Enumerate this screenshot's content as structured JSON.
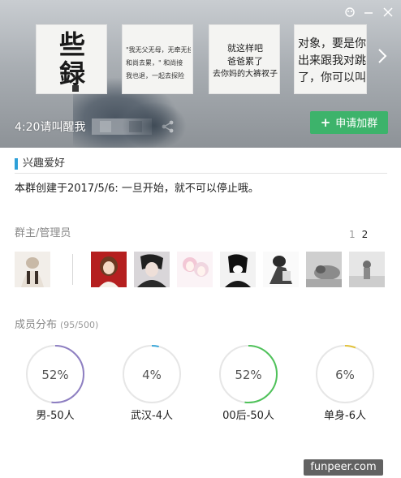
{
  "header": {
    "group_name": "4:20请叫醒我",
    "join_label": "申请加群",
    "thumbnails": [
      {
        "lines": [
          "些",
          "録"
        ]
      },
      {
        "lines": [
          "\"我无父无母，无牵无挂",
          "和尚去累，\" 和尚接",
          "我也退，一起去探险"
        ]
      },
      {
        "lines": [
          "就这样吧",
          "爸爸累了",
          "去你妈的大裤衩子"
        ]
      },
      {
        "lines": [
          "对象，要是你",
          "出来跟我对跳",
          "了，你可以叫"
        ]
      }
    ]
  },
  "interest": {
    "title": "兴趣爱好",
    "intro": "本群创建于2017/5/6:  一旦开始，就不可以停止哦。"
  },
  "admins": {
    "title": "群主/管理员",
    "pages": [
      "1",
      "2"
    ]
  },
  "distribution": {
    "title": "成员分布",
    "count": "(95/500)",
    "stats": [
      {
        "percent": "52%",
        "value": 0.52,
        "label": "男-50人",
        "color": "#8e7fc2"
      },
      {
        "percent": "4%",
        "value": 0.04,
        "label": "武汉-4人",
        "color": "#3aa7d9"
      },
      {
        "percent": "52%",
        "value": 0.52,
        "label": "00后-50人",
        "color": "#4fc25a"
      },
      {
        "percent": "6%",
        "value": 0.06,
        "label": "单身-6人",
        "color": "#e2c23a"
      }
    ]
  },
  "watermark": "funpeer.com",
  "colors": {
    "join_button": "#3db36b",
    "tag_bar": "#2ea0d8",
    "ring_track": "#e6e6e6"
  },
  "icons": [
    "skin-icon",
    "minimize-icon",
    "close-icon",
    "share-icon",
    "next-arrow-icon",
    "plus-icon"
  ]
}
